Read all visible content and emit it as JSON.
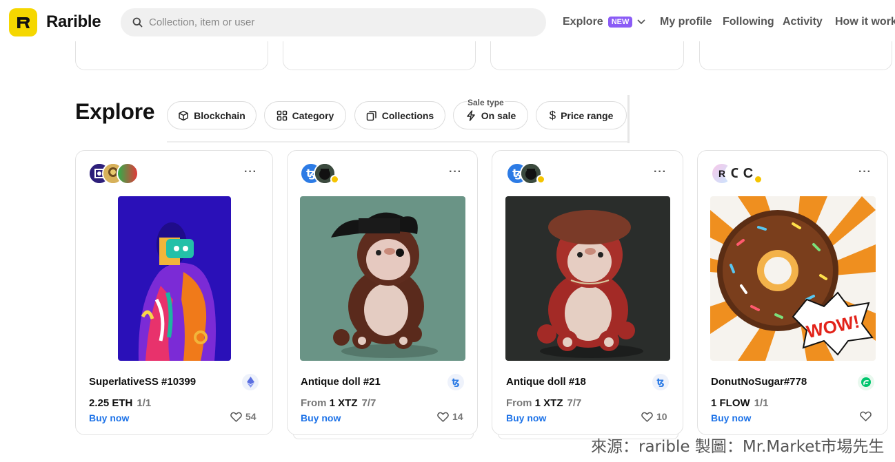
{
  "header": {
    "logo_text": "Rarible",
    "search_placeholder": "Collection, item or user",
    "nav": {
      "explore": "Explore",
      "explore_badge": "NEW",
      "my_profile": "My profile",
      "following": "Following",
      "activity": "Activity",
      "how_it_works": "How it work"
    }
  },
  "explore": {
    "title": "Explore",
    "filters": {
      "blockchain": "Blockchain",
      "category": "Category",
      "collections": "Collections",
      "sale_type_caption": "Sale type",
      "sale_type": "On sale",
      "price_range": "Price range"
    }
  },
  "cards": [
    {
      "name": "SuperlativeSS #10399",
      "price_prefix": "",
      "price": "2.25 ETH",
      "edition": "1/1",
      "buy": "Buy now",
      "likes": "54",
      "chain": "ethereum-icon"
    },
    {
      "name": "Antique doll #21",
      "price_prefix": "From",
      "price": "1 XTZ",
      "edition": "7/7",
      "buy": "Buy now",
      "likes": "14",
      "chain": "tezos-icon"
    },
    {
      "name": "Antique doll #18",
      "price_prefix": "From",
      "price": "1 XTZ",
      "edition": "7/7",
      "buy": "Buy now",
      "likes": "10",
      "chain": "tezos-icon"
    },
    {
      "name": "DonutNoSugar#778",
      "price_prefix": "",
      "price": "1 FLOW",
      "edition": "1/1",
      "buy": "Buy now",
      "likes": "",
      "chain": "flow-icon"
    }
  ],
  "watermark": "來源：rarible 製圖：Mr.Market市場先生",
  "colors": {
    "logo": "#f5d700",
    "new_badge": "#8b5cf6",
    "link": "#1e73e8"
  }
}
